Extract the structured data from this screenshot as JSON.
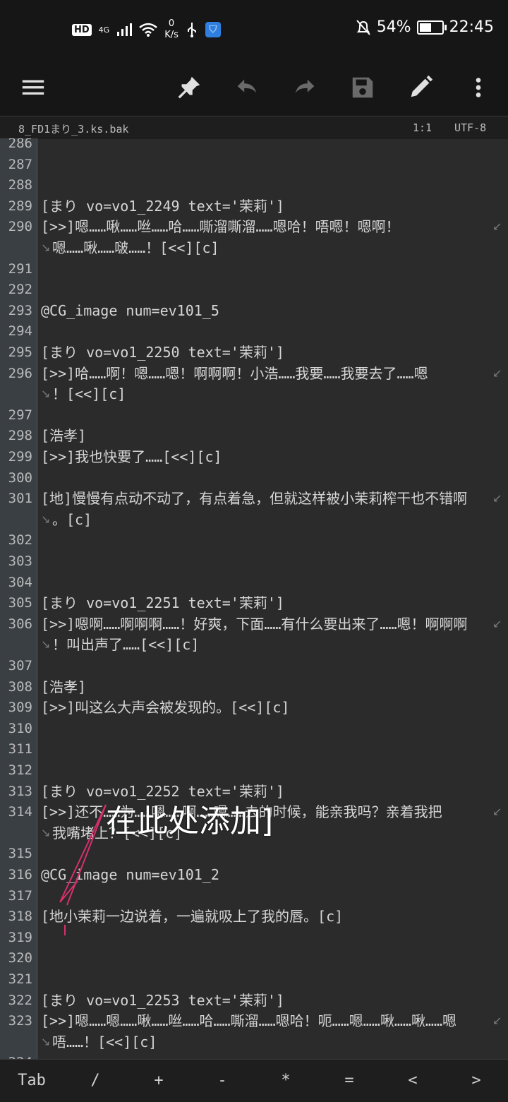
{
  "status_bar": {
    "network": "HD",
    "signal": "4G",
    "speed_value": "0",
    "speed_unit": "K/s",
    "battery": "54%",
    "battery_level": 0.54,
    "time": "22:45"
  },
  "toolbar": {
    "icons": [
      "menu-icon",
      "pin-icon",
      "undo-icon",
      "redo-icon",
      "save-icon",
      "edit-icon",
      "more-vert-icon"
    ]
  },
  "file_bar": {
    "filename": "8_FD1まり_3.ks.bak",
    "position": "1:1",
    "encoding": "UTF-8"
  },
  "editor": {
    "lines": [
      {
        "num": "286",
        "text": ""
      },
      {
        "num": "287",
        "text": ""
      },
      {
        "num": "288",
        "text": ""
      },
      {
        "num": "289",
        "text": "[まり vo=vo1_2249 text='茉莉']"
      },
      {
        "num": "290",
        "text": "[>>]嗯……啾……咝……哈……嘶溜嘶溜……嗯哈！唔嗯！嗯啊！"
      },
      {
        "num": "",
        "text": "嗯……啾……啵……！[<<][c]",
        "cont": true
      },
      {
        "num": "291",
        "text": ""
      },
      {
        "num": "292",
        "text": ""
      },
      {
        "num": "293",
        "text": "@CG_image num=ev101_5"
      },
      {
        "num": "294",
        "text": ""
      },
      {
        "num": "295",
        "text": "[まり vo=vo1_2250 text='茉莉']"
      },
      {
        "num": "296",
        "text": "[>>]哈……啊！嗯……嗯！啊啊啊！小浩……我要……我要去了……嗯"
      },
      {
        "num": "",
        "text": "！[<<][c]",
        "cont": true
      },
      {
        "num": "297",
        "text": ""
      },
      {
        "num": "298",
        "text": "[浩孝]"
      },
      {
        "num": "299",
        "text": "[>>]我也快要了……[<<][c]"
      },
      {
        "num": "300",
        "text": ""
      },
      {
        "num": "301",
        "text": "[地]慢慢有点动不动了，有点着急，但就这样被小茉莉榨干也不错啊"
      },
      {
        "num": "",
        "text": "。[c]",
        "cont": true
      },
      {
        "num": "302",
        "text": ""
      },
      {
        "num": "303",
        "text": ""
      },
      {
        "num": "304",
        "text": ""
      },
      {
        "num": "305",
        "text": "[まり vo=vo1_2251 text='茉莉']"
      },
      {
        "num": "306",
        "text": "[>>]嗯啊……啊啊啊……！好爽，下面……有什么要出来了……嗯！啊啊啊"
      },
      {
        "num": "",
        "text": "！叫出声了……[<<][c]",
        "cont": true
      },
      {
        "num": "307",
        "text": ""
      },
      {
        "num": "308",
        "text": "[浩孝]"
      },
      {
        "num": "309",
        "text": "[>>]叫这么大声会被发现的。[<<][c]"
      },
      {
        "num": "310",
        "text": ""
      },
      {
        "num": "311",
        "text": ""
      },
      {
        "num": "312",
        "text": ""
      },
      {
        "num": "313",
        "text": "[まり vo=vo1_2252 text='茉莉']"
      },
      {
        "num": "314",
        "text": "[>>]还不……为……嗯……啊……嗯……去的时候，能亲我吗？亲着我把"
      },
      {
        "num": "",
        "text": "我嘴堵上？[<<][c]",
        "cont": true
      },
      {
        "num": "315",
        "text": ""
      },
      {
        "num": "316",
        "text": "@CG_image num=ev101_2"
      },
      {
        "num": "317",
        "text": ""
      },
      {
        "num": "318",
        "text": "[地小茉莉一边说着，一遍就吸上了我的唇。[c]"
      },
      {
        "num": "319",
        "text": ""
      },
      {
        "num": "320",
        "text": ""
      },
      {
        "num": "321",
        "text": ""
      },
      {
        "num": "322",
        "text": "[まり vo=vo1_2253 text='茉莉']"
      },
      {
        "num": "323",
        "text": "[>>]嗯……嗯……啾……咝……哈……嘶溜……嗯哈！呃……嗯……啾……啾……嗯"
      },
      {
        "num": "",
        "text": "唔……！[<<][c]",
        "cont": true
      },
      {
        "num": "324",
        "text": ""
      }
    ]
  },
  "annotation": {
    "text": "在此处添加]",
    "stroke_color": "#d6306c"
  },
  "keys": [
    "Tab",
    "/",
    "+",
    "-",
    "*",
    "=",
    "<",
    ">"
  ],
  "colors": {
    "background": "#2b2b2b",
    "gutter": "#3a3f44",
    "bar": "#161616"
  }
}
